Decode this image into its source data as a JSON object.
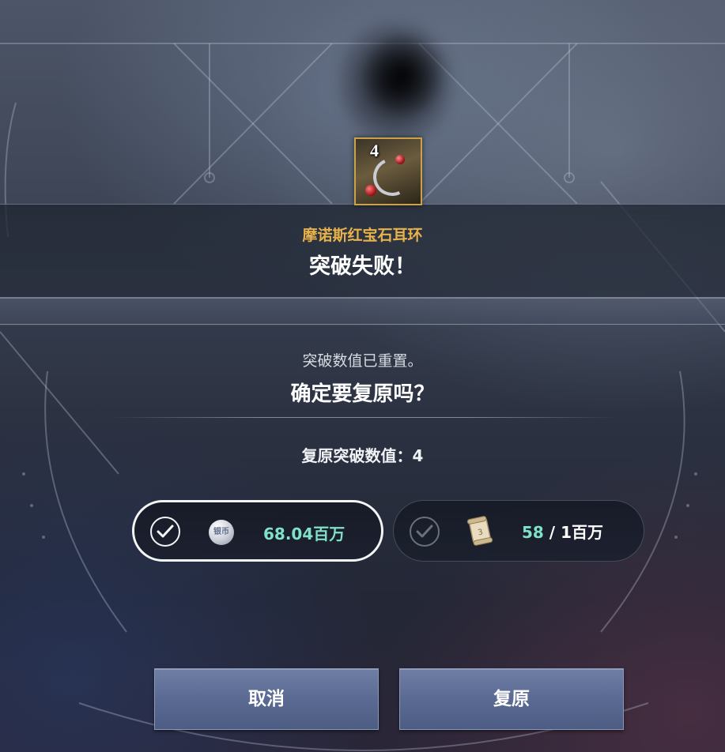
{
  "item": {
    "name": "摩诺斯红宝石耳环",
    "level": "4",
    "icon": "ruby-earring-icon"
  },
  "result": {
    "fail_text": "突破失败！"
  },
  "dialog": {
    "reset_text": "突破数值已重置。",
    "confirm_text": "确定要复原吗？",
    "restore_value_text": "复原突破数值：4"
  },
  "options": {
    "silver": {
      "icon": "silver-coin-icon",
      "coin_label": "银币",
      "amount": "68.04百万",
      "selected": true
    },
    "scroll": {
      "icon": "scroll-icon",
      "have": "58",
      "need": " / 1百万",
      "selected": false
    }
  },
  "buttons": {
    "cancel": "取消",
    "restore": "复原"
  },
  "colors": {
    "item_name": "#e8b24a",
    "amount_teal": "#7fe2c8",
    "button": "#5a6a92"
  }
}
